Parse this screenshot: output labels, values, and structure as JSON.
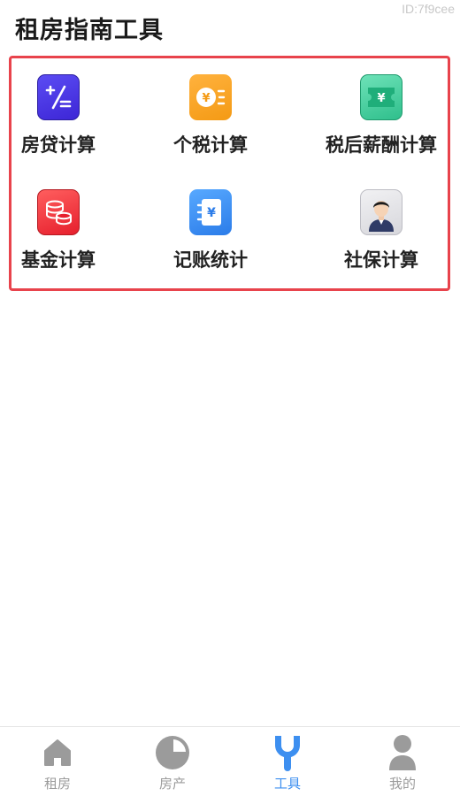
{
  "watermark_id": "ID:7f9cee",
  "page_title": "租房指南工具",
  "tools": [
    {
      "label": "房贷计算",
      "icon": "plus-divide-icon",
      "color": "#4a3ae8"
    },
    {
      "label": "个税计算",
      "icon": "coin-list-icon",
      "color": "#f5a623"
    },
    {
      "label": "税后薪酬计算",
      "icon": "ticket-yen-icon",
      "color": "#3cc896"
    },
    {
      "label": "基金计算",
      "icon": "coin-stack-icon",
      "color": "#f0333a"
    },
    {
      "label": "记账统计",
      "icon": "notebook-yen-icon",
      "color": "#3a8ef0"
    },
    {
      "label": "社保计算",
      "icon": "person-avatar-icon",
      "color": "#d9d9de"
    }
  ],
  "tabbar": {
    "items": [
      {
        "label": "租房",
        "icon": "house-icon",
        "active": false
      },
      {
        "label": "房产",
        "icon": "pie-chart-icon",
        "active": false
      },
      {
        "label": "工具",
        "icon": "wrench-icon",
        "active": true
      },
      {
        "label": "我的",
        "icon": "user-icon",
        "active": false
      }
    ],
    "active_color": "#3d8ff0",
    "inactive_color": "#9b9b9b"
  }
}
